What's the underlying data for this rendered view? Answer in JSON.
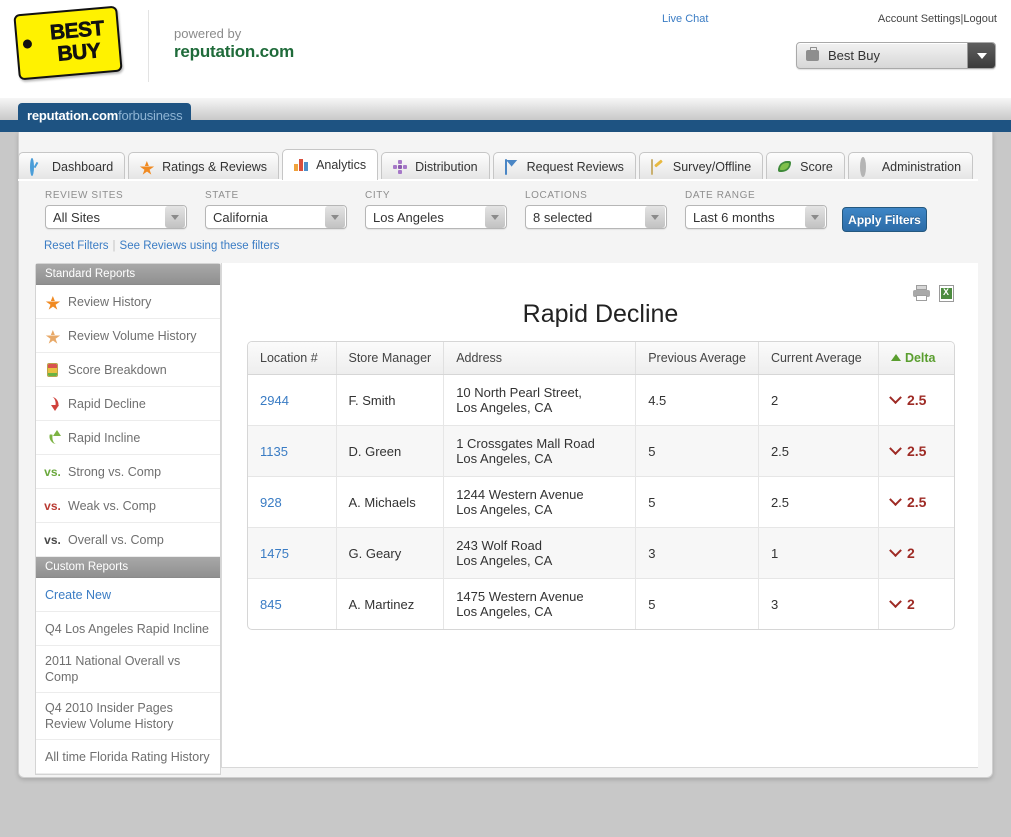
{
  "header": {
    "brand_logo_line1": "BEST",
    "brand_logo_line2": "BUY",
    "powered_by": "powered by",
    "powered_brand": "reputation.com",
    "live_chat": "Live Chat",
    "account_settings": "Account Settings",
    "account_separator": "|",
    "logout": "Logout",
    "account_selected": "Best Buy"
  },
  "brandbar": {
    "title_main": "reputation.com",
    "title_sub": "forbusiness"
  },
  "tabs": [
    {
      "label": "Dashboard",
      "icon": "speedometer-icon",
      "active": false
    },
    {
      "label": "Ratings & Reviews",
      "icon": "star-icon",
      "active": false
    },
    {
      "label": "Analytics",
      "icon": "bar-chart-icon",
      "active": true
    },
    {
      "label": "Distribution",
      "icon": "network-icon",
      "active": false
    },
    {
      "label": "Request Reviews",
      "icon": "envelope-icon",
      "active": false
    },
    {
      "label": "Survey/Offline",
      "icon": "pencil-icon",
      "active": false
    },
    {
      "label": "Score",
      "icon": "leaf-icon",
      "active": false
    },
    {
      "label": "Administration",
      "icon": "gear-icon",
      "active": false
    }
  ],
  "filters": {
    "fields": [
      {
        "label": "REVIEW SITES",
        "value": "All Sites",
        "name": "review-sites"
      },
      {
        "label": "STATE",
        "value": "California",
        "name": "state"
      },
      {
        "label": "CITY",
        "value": "Los Angeles",
        "name": "city"
      },
      {
        "label": "LOCATIONS",
        "value": "8 selected",
        "name": "locations"
      },
      {
        "label": "DATE RANGE",
        "value": "Last 6 months",
        "name": "date-range"
      }
    ],
    "apply_label": "Apply Filters",
    "reset_label": "Reset Filters",
    "see_reviews_label": "See Reviews using these filters"
  },
  "sidebar": {
    "standard_heading": "Standard Reports",
    "standard_items": [
      {
        "label": "Review History",
        "icon": "star-icon"
      },
      {
        "label": "Review Volume History",
        "icon": "star-faded-icon"
      },
      {
        "label": "Score Breakdown",
        "icon": "score-bars-icon"
      },
      {
        "label": "Rapid Decline",
        "icon": "arrow-down-icon"
      },
      {
        "label": "Rapid Incline",
        "icon": "arrow-up-icon"
      },
      {
        "label": "Strong vs. Comp",
        "icon": "vs-green-icon"
      },
      {
        "label": "Weak vs. Comp",
        "icon": "vs-red-icon"
      },
      {
        "label": "Overall vs. Comp",
        "icon": "vs-dark-icon"
      }
    ],
    "custom_heading": "Custom Reports",
    "custom_items": [
      {
        "label": "Create New",
        "link": true
      },
      {
        "label": "Q4 Los Angeles Rapid Incline",
        "link": false
      },
      {
        "label": "2011 National Overall vs Comp",
        "link": false
      },
      {
        "label": "Q4 2010 Insider Pages Review Volume History",
        "link": false
      },
      {
        "label": "All time Florida Rating History",
        "link": false
      }
    ]
  },
  "main": {
    "report_title": "Rapid Decline",
    "print_icon": "printer-icon",
    "export_icon": "excel-export-icon",
    "columns": [
      "Location #",
      "Store Manager",
      "Address",
      "Previous Average",
      "Current Average",
      "Delta"
    ],
    "sorted_column": "Delta",
    "sort_direction": "ascending",
    "rows": [
      {
        "location": "2944",
        "manager": "F. Smith",
        "address_line1": "10 North Pearl Street,",
        "address_line2": "Los Angeles, CA",
        "previous_average": "4.5",
        "current_average": "2",
        "delta": "2.5",
        "delta_direction": "down"
      },
      {
        "location": "1135",
        "manager": "D. Green",
        "address_line1": "1 Crossgates Mall Road",
        "address_line2": "Los Angeles, CA",
        "previous_average": "5",
        "current_average": "2.5",
        "delta": "2.5",
        "delta_direction": "down"
      },
      {
        "location": "928",
        "manager": "A. Michaels",
        "address_line1": "1244 Western Avenue",
        "address_line2": "Los Angeles, CA",
        "previous_average": "5",
        "current_average": "2.5",
        "delta": "2.5",
        "delta_direction": "down"
      },
      {
        "location": "1475",
        "manager": "G. Geary",
        "address_line1": "243 Wolf Road",
        "address_line2": "Los Angeles, CA",
        "previous_average": "3",
        "current_average": "1",
        "delta": "2",
        "delta_direction": "down"
      },
      {
        "location": "845",
        "manager": "A. Martinez",
        "address_line1": "1475 Western Avenue",
        "address_line2": "Los Angeles, CA",
        "previous_average": "5",
        "current_average": "3",
        "delta": "2",
        "delta_direction": "down"
      }
    ]
  },
  "colors": {
    "brand_blue": "#1e5382",
    "link_blue": "#3a7cc4",
    "accent_green": "#5a9e2f",
    "delta_red": "#9e2b25",
    "bestbuy_yellow": "#fff200"
  }
}
